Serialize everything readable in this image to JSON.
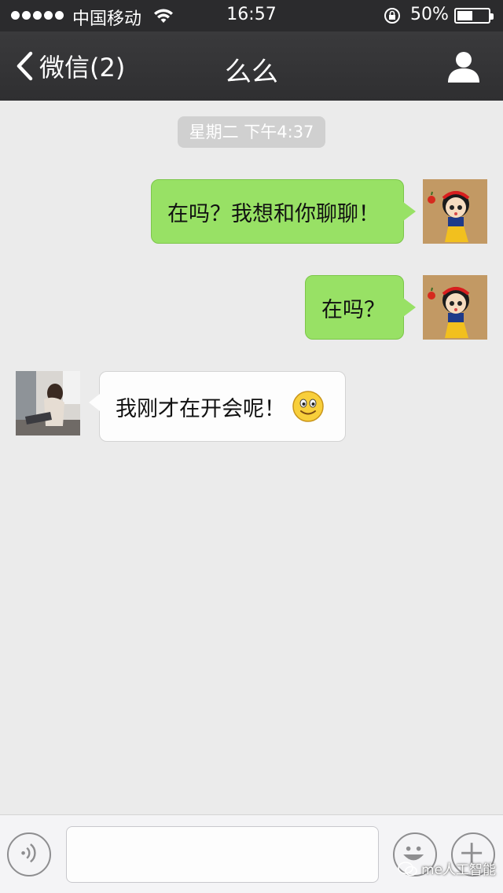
{
  "status_bar": {
    "carrier": "中国移动",
    "time": "16:57",
    "battery": "50%",
    "battery_level": 0.5
  },
  "nav": {
    "back_label": "微信(2)",
    "title": "么么",
    "back_icon": "chevron-left-icon",
    "profile_icon": "person-icon"
  },
  "chat": {
    "timestamp": "星期二 下午4:37",
    "messages": [
      {
        "direction": "sent",
        "text": "在吗？我想和你聊聊！"
      },
      {
        "direction": "sent",
        "text": "在吗？"
      },
      {
        "direction": "received",
        "text": "我刚才在开会呢！",
        "emoji": "smiley-emoji"
      }
    ]
  },
  "input_bar": {
    "voice_icon": "voice-icon",
    "emoji_icon": "smiley-icon",
    "plus_icon": "plus-icon",
    "text_value": ""
  },
  "watermark": {
    "text": "me人工智能"
  },
  "colors": {
    "sent_bubble": "#98e165",
    "received_bubble": "#fdfdfd",
    "nav_background": "#333335",
    "chat_background": "#ebebeb"
  }
}
